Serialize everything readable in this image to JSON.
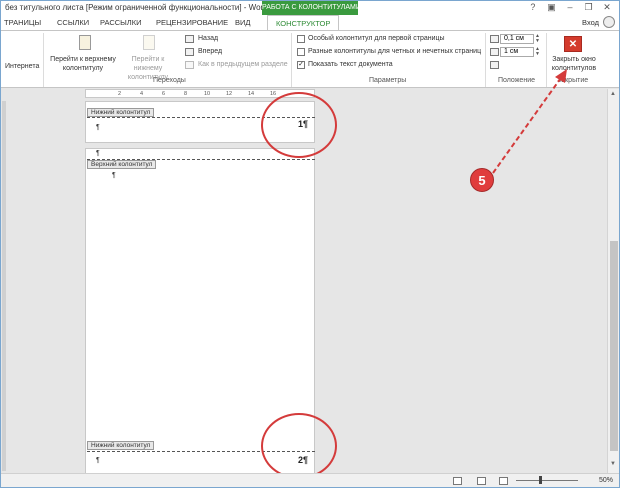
{
  "window": {
    "title": "без титульного листа [Режим ограниченной функциональности] - Word",
    "context_tab": "РАБОТА С КОЛОНТИТУЛАМИ",
    "controls": [
      "?",
      "▣",
      "–",
      "❐",
      "✕"
    ]
  },
  "tabs": {
    "items": [
      "ТРАНИЦЫ",
      "ССЫЛКИ",
      "РАССЫЛКИ",
      "РЕЦЕНЗИРОВАНИЕ",
      "ВИД",
      "КОНСТРУКТОР"
    ],
    "login": "Вход"
  },
  "ribbon": {
    "internet_label": "Интернета",
    "go_to_header": "Перейти к верхнему колонтитулу",
    "go_to_footer": "Перейти к нижнему колонтитулу",
    "back": "Назад",
    "forward": "Вперед",
    "link_prev": "Как в предыдущем разделе",
    "group_navigation": "Переходы",
    "opt_first_page": "Особый колонтитул для первой страницы",
    "opt_odd_even": "Разные колонтитулы для четных и нечетных страниц",
    "opt_show_text": "Показать текст документа",
    "group_options": "Параметры",
    "header_pos": "0,1 см",
    "footer_pos": "1 см",
    "group_position": "Положение",
    "close_button": "Закрыть окно колонтитулов",
    "group_close": "Закрытие"
  },
  "ruler": {
    "marks": [
      "2",
      "4",
      "6",
      "8",
      "10",
      "12",
      "14",
      "16"
    ]
  },
  "document": {
    "footer_label": "Нижний колонтитул",
    "header_label": "Верхний колонтитул",
    "paragraph_mark": "¶",
    "page1_number": "1¶",
    "page2_number": "2¶"
  },
  "annotation": {
    "step": "5"
  },
  "statusbar": {
    "zoom": "50%"
  },
  "colors": {
    "accent_green": "#3a9a3e",
    "close_red": "#d43b2d",
    "circle_red": "#d43b3b"
  }
}
